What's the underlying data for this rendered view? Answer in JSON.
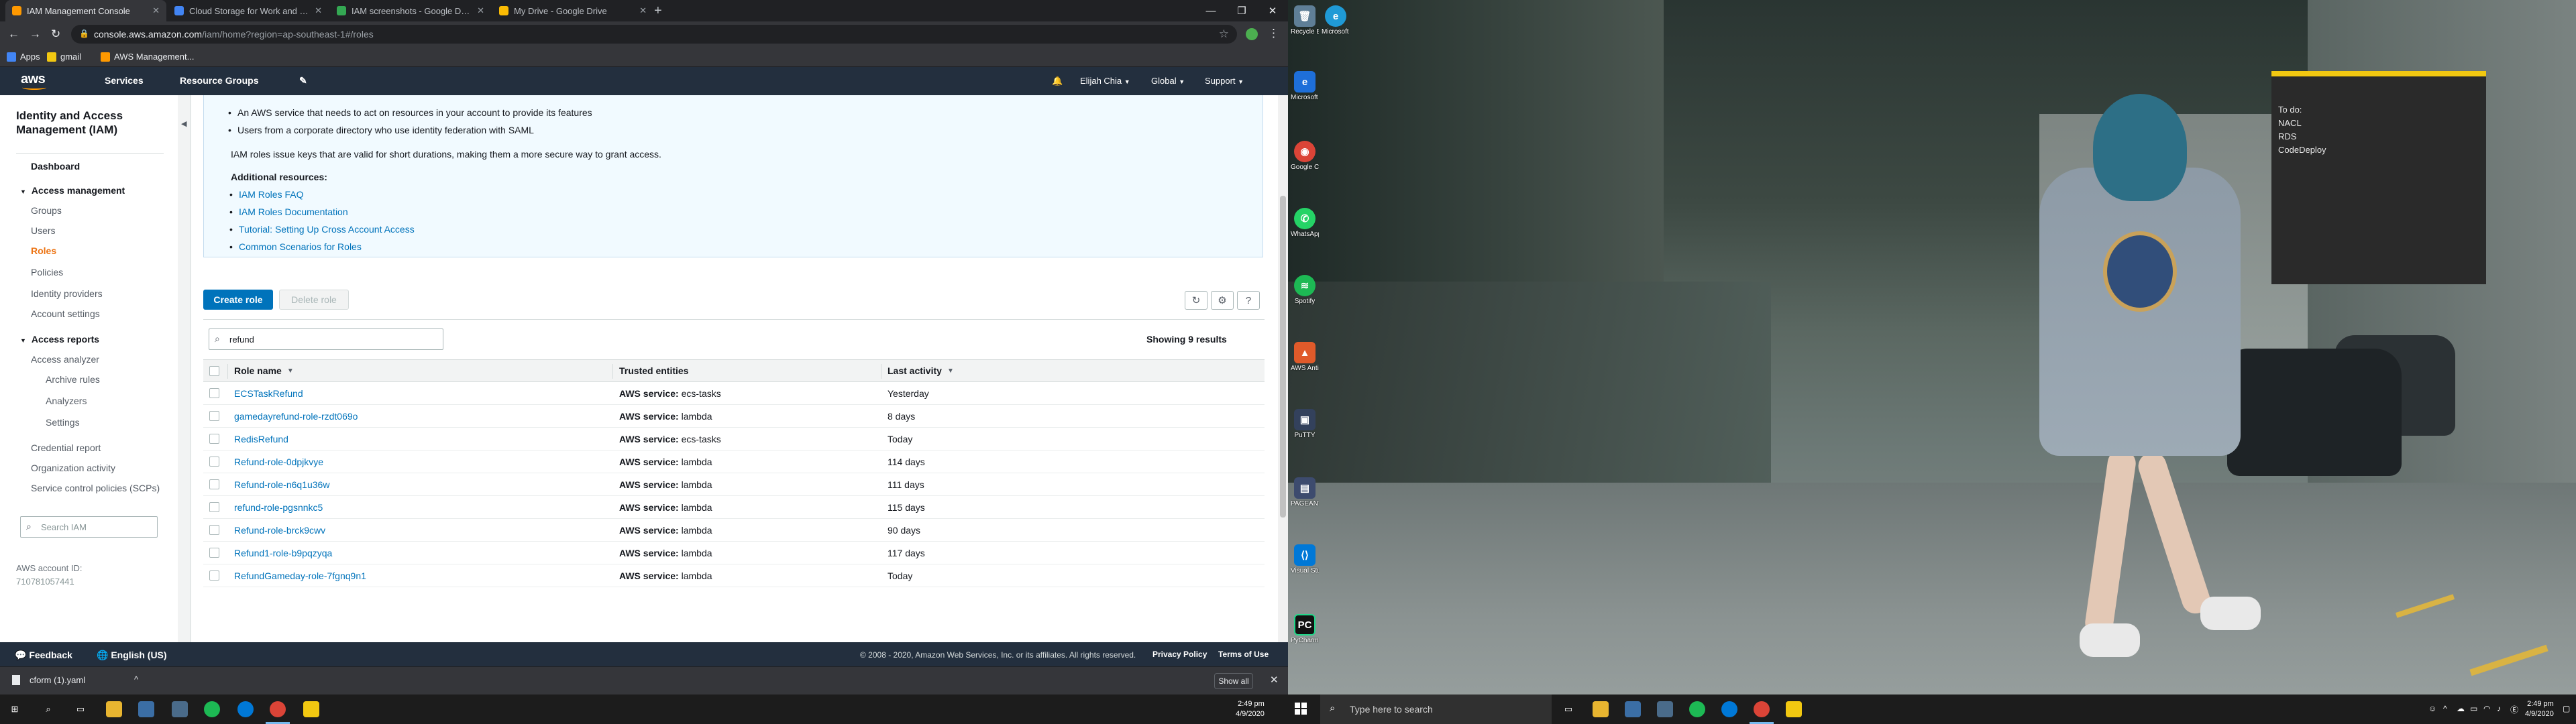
{
  "browser": {
    "tabs": [
      {
        "title": "IAM Management Console",
        "active": true
      },
      {
        "title": "Cloud Storage for Work and Ho",
        "active": false
      },
      {
        "title": "IAM screenshots - Google Drive",
        "active": false
      },
      {
        "title": "My Drive - Google Drive",
        "active": false
      }
    ],
    "new_tab": "+",
    "url_host": "console.aws.amazon.com",
    "url_path": "/iam/home?region=ap-southeast-1#/roles",
    "bookmarks": [
      "Apps",
      "gmail",
      "AWS Management..."
    ]
  },
  "aws_nav": {
    "logo_text": "aws",
    "services": "Services",
    "resource_groups": "Resource Groups",
    "user": "Elijah Chia",
    "region": "Global",
    "support": "Support"
  },
  "iam_side": {
    "title": "Identity and Access Management (IAM)",
    "dashboard": "Dashboard",
    "access_management": "Access management",
    "groups": "Groups",
    "users": "Users",
    "roles": "Roles",
    "policies": "Policies",
    "identity_providers": "Identity providers",
    "account_settings": "Account settings",
    "access_reports": "Access reports",
    "access_analyzer": "Access analyzer",
    "archive_rules": "Archive rules",
    "analyzers": "Analyzers",
    "settings": "Settings",
    "credential_report": "Credential report",
    "organization_activity": "Organization activity",
    "scps": "Service control policies (SCPs)",
    "search_placeholder": "Search IAM",
    "account_label": "AWS account ID:",
    "account_id": "710781057441"
  },
  "info": {
    "bullet1": "An AWS service that needs to act on resources in your account to provide its features",
    "bullet2": "Users from a corporate directory who use identity federation with SAML",
    "roles_note": "IAM roles issue keys that are valid for short durations, making them a more secure way to grant access.",
    "additional_resources": "Additional resources:",
    "links": [
      "IAM Roles FAQ",
      "IAM Roles Documentation",
      "Tutorial: Setting Up Cross Account Access",
      "Common Scenarios for Roles"
    ]
  },
  "toolbar": {
    "create_role": "Create role",
    "delete_role": "Delete role",
    "filter_value": "refund",
    "showing": "Showing 9 results"
  },
  "table": {
    "columns": [
      "Role name",
      "Trusted entities",
      "Last activity"
    ],
    "service_prefix": "AWS service:",
    "rows": [
      {
        "name": "ECSTaskRefund",
        "service": "ecs-tasks",
        "activity": "Yesterday"
      },
      {
        "name": "gamedayrefund-role-rzdt069o",
        "service": "lambda",
        "activity": "8 days"
      },
      {
        "name": "RedisRefund",
        "service": "ecs-tasks",
        "activity": "Today"
      },
      {
        "name": "Refund-role-0dpjkvye",
        "service": "lambda",
        "activity": "114 days"
      },
      {
        "name": "Refund-role-n6q1u36w",
        "service": "lambda",
        "activity": "111 days"
      },
      {
        "name": "refund-role-pgsnnkc5",
        "service": "lambda",
        "activity": "115 days"
      },
      {
        "name": "Refund-role-brck9cwv",
        "service": "lambda",
        "activity": "90 days"
      },
      {
        "name": "Refund1-role-b9pqzyqa",
        "service": "lambda",
        "activity": "117 days"
      },
      {
        "name": "RefundGameday-role-7fgnq9n1",
        "service": "lambda",
        "activity": "Today"
      }
    ]
  },
  "footer": {
    "feedback": "Feedback",
    "language": "English (US)",
    "copyright": "© 2008 - 2020, Amazon Web Services, Inc. or its affiliates. All rights reserved.",
    "privacy": "Privacy Policy",
    "terms": "Terms of Use"
  },
  "downloads": {
    "file": "cform (1).yaml",
    "show_all": "Show all"
  },
  "clock": {
    "time": "2:49 pm",
    "date": "4/9/2020"
  },
  "desktop": {
    "icons": [
      "Recycle Bin",
      "Microsoft Edge",
      "Microsoft Edge",
      "Google Chrome",
      "WhatsApp",
      "Spotify",
      "AWS AntiVirus",
      "PuTTY",
      "PAGEANT",
      "Visual Studio Code",
      "PyCharm Community"
    ],
    "sticky_lines": [
      "To do:",
      "NACL",
      "RDS",
      "CodeDeploy"
    ],
    "search_placeholder": "Type here to search"
  },
  "colors": {
    "aws_nav": "#232f3e",
    "aws_orange": "#ff9900",
    "primary_button": "#0073bb",
    "link": "#0073bb",
    "active_nav": "#ec7211",
    "sticky_accent": "#f2c811"
  }
}
